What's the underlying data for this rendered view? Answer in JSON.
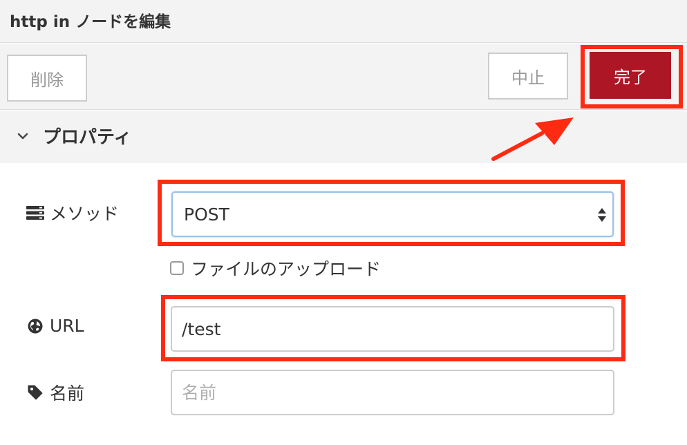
{
  "dialog": {
    "title": "http in ノードを編集"
  },
  "toolbar": {
    "delete_label": "削除",
    "cancel_label": "中止",
    "done_label": "完了"
  },
  "properties": {
    "section_title": "プロパティ",
    "method": {
      "label": "メソッド",
      "value": "POST"
    },
    "upload": {
      "label": "ファイルのアップロード",
      "checked": false
    },
    "url": {
      "label": "URL",
      "value": "/test"
    },
    "name": {
      "label": "名前",
      "placeholder": "名前",
      "value": ""
    }
  },
  "icons": {
    "chevron": "chevron-down-icon",
    "method": "server-list-icon",
    "url": "globe-icon",
    "name": "tag-icon",
    "select": "sort-arrows-icon"
  },
  "colors": {
    "primary_button": "#ad1625",
    "annotation": "#ff2a12",
    "panel_background": "#f3f3f3"
  }
}
